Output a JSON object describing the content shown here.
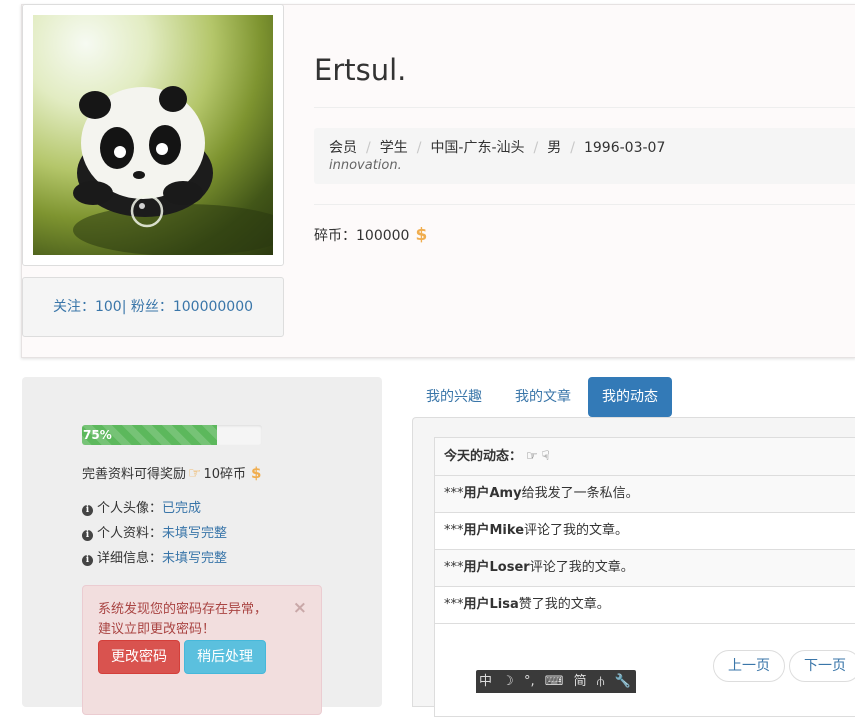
{
  "profile": {
    "name": "Ertsul.",
    "follow_text": "关注：100| 粉丝：100000000",
    "tags": [
      "会员",
      "学生",
      "中国-广东-汕头",
      "男",
      "1996-03-07"
    ],
    "motto": "innovation.",
    "coins_label": "碎币：",
    "coins_value": "100000",
    "coin_icon": "$"
  },
  "completion": {
    "progress_label": "75%",
    "progress_percent": 75,
    "reward_prefix": "完善资料可得奖励",
    "reward_hand": "☞",
    "reward_value": "10碎币",
    "reward_coin": "$",
    "items": [
      {
        "label": "个人头像：",
        "value": "已完成"
      },
      {
        "label": "个人资料：",
        "value": "未填写完整"
      },
      {
        "label": "详细信息：",
        "value": "未填写完整"
      }
    ]
  },
  "alert": {
    "line1": "系统发现您的密码存在异常，",
    "line2": "建议立即更改密码！",
    "close": "×",
    "primary_label": "更改密码",
    "secondary_label": "稍后处理"
  },
  "tabs": [
    {
      "label": "我的兴趣",
      "active": false
    },
    {
      "label": "我的文章",
      "active": false
    },
    {
      "label": "我的动态",
      "active": true
    }
  ],
  "feed": {
    "title": "今天的动态：",
    "thumb_up": "👍",
    "thumb_down": "👎",
    "rows": [
      {
        "prefix": "***",
        "user": "用户Amy",
        "text": "给我发了一条私信。"
      },
      {
        "prefix": "***",
        "user": "用户Mike",
        "text": "评论了我的文章。"
      },
      {
        "prefix": "***",
        "user": "用户Loser",
        "text": "评论了我的文章。"
      },
      {
        "prefix": "***",
        "user": "用户Lisa",
        "text": "赞了我的文章。"
      }
    ]
  },
  "pager": {
    "prev_label": "上一页",
    "next_label": "下一页"
  },
  "ime_bar": {
    "items": [
      "中",
      "☽",
      "°,",
      "⌨",
      "简",
      "⫛",
      "🔧"
    ]
  },
  "colors": {
    "link": "#3a76a9",
    "primary": "#337ab7",
    "success": "#5cb85c",
    "danger": "#d9534f",
    "info": "#5bc0de",
    "warning": "#f0ad4e"
  }
}
